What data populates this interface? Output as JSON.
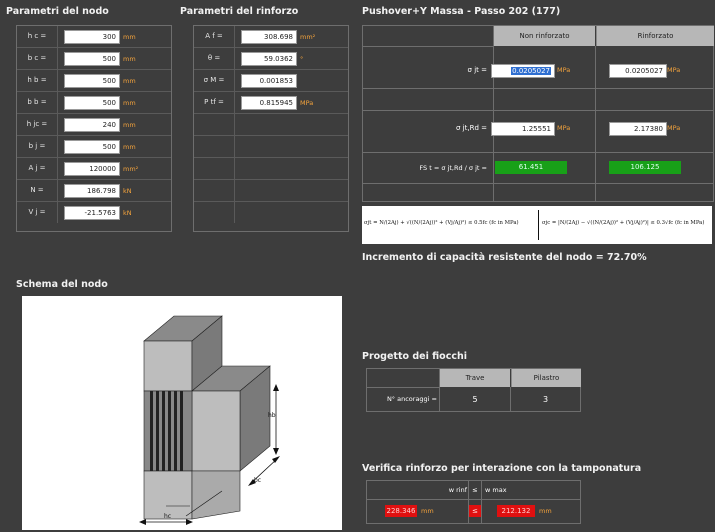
{
  "left_section": {
    "title": "Parametri del nodo",
    "rows": [
      {
        "label": "h c =",
        "value": "300",
        "unit": "mm"
      },
      {
        "label": "b c =",
        "value": "500",
        "unit": "mm"
      },
      {
        "label": "h b =",
        "value": "500",
        "unit": "mm"
      },
      {
        "label": "b b =",
        "value": "500",
        "unit": "mm"
      },
      {
        "label": "h jc =",
        "value": "240",
        "unit": "mm"
      },
      {
        "label": "b j =",
        "value": "500",
        "unit": "mm"
      },
      {
        "label": "A j =",
        "value": "120000",
        "unit": "mm²"
      },
      {
        "label": "N =",
        "value": "186.798",
        "unit": "kN"
      },
      {
        "label": "V j =",
        "value": "-21.5763",
        "unit": "kN"
      }
    ]
  },
  "mid_section": {
    "title": "Parametri del rinforzo",
    "rows": [
      {
        "label": "A f =",
        "value": "308.698",
        "unit": "mm²"
      },
      {
        "label": "θ =",
        "value": "59.0362",
        "unit": "°"
      },
      {
        "label": "σ M =",
        "value": "0.001853",
        "unit": ""
      },
      {
        "label": "P tf =",
        "value": "0.815945",
        "unit": "MPa"
      },
      {
        "label": "",
        "value": "",
        "unit": ""
      },
      {
        "label": "",
        "value": "",
        "unit": ""
      },
      {
        "label": "",
        "value": "",
        "unit": ""
      },
      {
        "label": "",
        "value": "",
        "unit": ""
      },
      {
        "label": "",
        "value": "",
        "unit": ""
      }
    ]
  },
  "pushover": {
    "title": "Pushover+Y Massa - Passo 202 (177)",
    "col_headers": [
      "Non rinforzato",
      "Rinforzato"
    ],
    "rows": [
      {
        "label": "σ jt =",
        "v1": "0.0205027",
        "u1": "MPa",
        "v2": "0.0205027",
        "u2": "MPa"
      },
      {
        "label": "σ jt,Rd =",
        "v1": "1.25551",
        "u1": "MPa",
        "v2": "2.17380",
        "u2": "MPa"
      },
      {
        "label": "FS t = σ jt,Rd / σ jt =",
        "v1": "61.451",
        "u1": "",
        "v2": "106.125",
        "u2": ""
      }
    ],
    "formula_left": "σjt = N/(2Aj) + √((N/(2Aj))² + (Vj/Aj)²) ≤ 0.5fc (fc in MPa)",
    "formula_right": "σjc = |N/(2Aj) − √((N/(2Aj))² + (Vj/Aj)²)| ≤ 0.3√fc (fc in MPa)",
    "increment_label": "Incremento di capacità resistente del nodo = 72.70%"
  },
  "schema": {
    "title": "Schema del nodo",
    "dims": {
      "hc": "hc",
      "bc": "bc",
      "hb": "hb"
    }
  },
  "fiocchi": {
    "title": "Progetto dei fiocchi",
    "headers": [
      "Trave",
      "Pilastro"
    ],
    "row_label": "N° ancoraggi =",
    "values": [
      "5",
      "3"
    ]
  },
  "verifica": {
    "title": "Verifica rinforzo per interazione con la tamponatura",
    "header_left": "w rinf",
    "header_mid": "≤",
    "header_right": "w max",
    "value_left": "228.346",
    "unit_left": "mm",
    "value_right": "212.132",
    "unit_right": "mm",
    "sign": "≤"
  },
  "colors": {
    "background": "#3d3d3d",
    "unit": "#f2a23c",
    "green": "#18a018",
    "red": "#e01010",
    "header": "#b7b7b7"
  }
}
